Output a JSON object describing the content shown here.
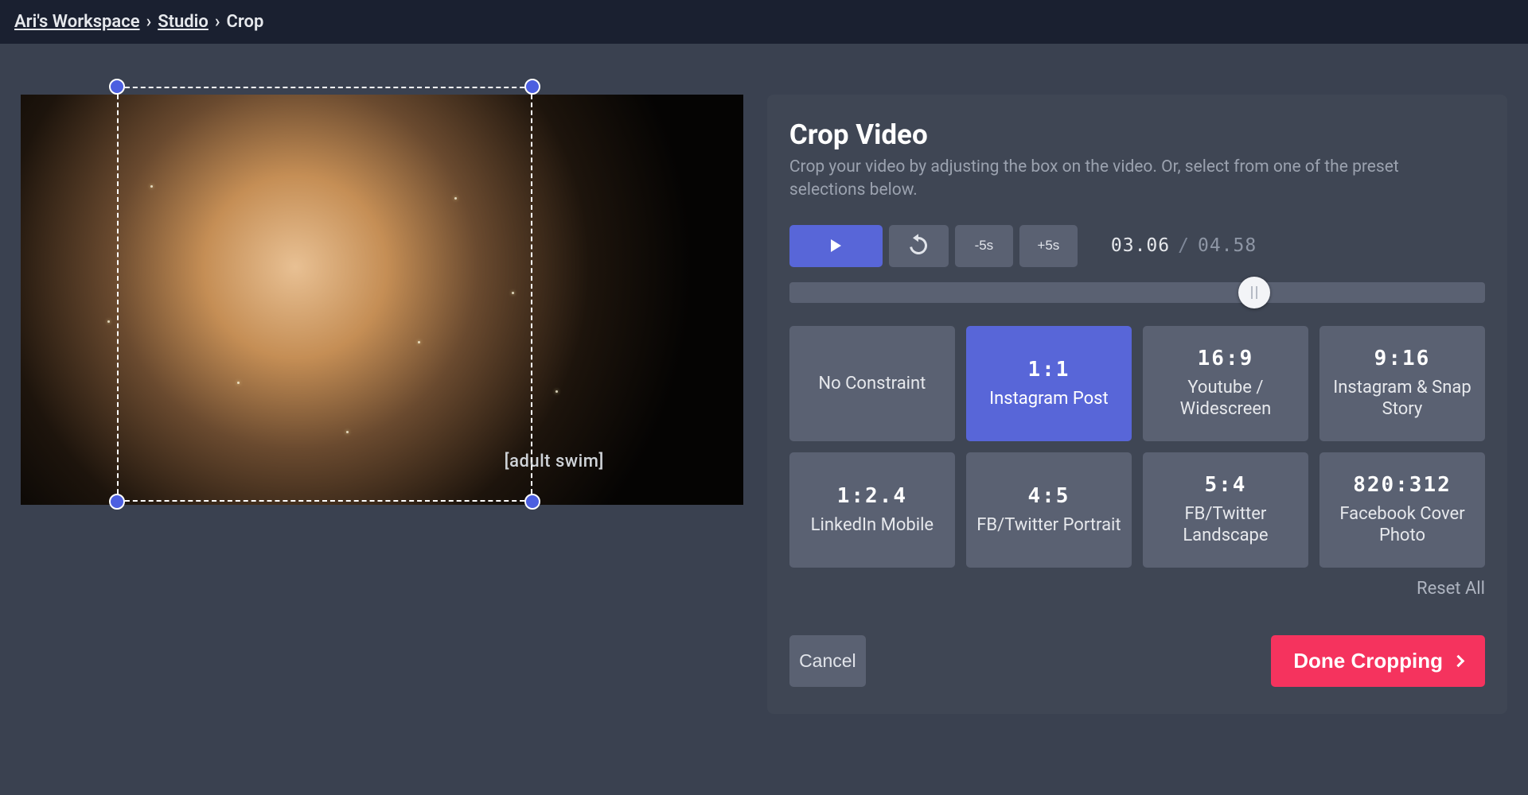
{
  "breadcrumb": {
    "workspace": "Ari's Workspace",
    "studio": "Studio",
    "current": "Crop"
  },
  "panel": {
    "title": "Crop Video",
    "subtitle": "Crop your video by adjusting the box on the video. Or, select from one of the preset selections below."
  },
  "controls": {
    "back5": "-5s",
    "fwd5": "+5s"
  },
  "time": {
    "current": "03.06",
    "total": "04.58",
    "progress_pct": 66.8
  },
  "presets": [
    {
      "ratio": "",
      "label": "No Constraint",
      "selected": false
    },
    {
      "ratio": "1:1",
      "label": "Instagram Post",
      "selected": true
    },
    {
      "ratio": "16:9",
      "label": "Youtube / Widescreen",
      "selected": false
    },
    {
      "ratio": "9:16",
      "label": "Instagram & Snap Story",
      "selected": false
    },
    {
      "ratio": "1:2.4",
      "label": "LinkedIn Mobile",
      "selected": false
    },
    {
      "ratio": "4:5",
      "label": "FB/Twitter Portrait",
      "selected": false
    },
    {
      "ratio": "5:4",
      "label": "FB/Twitter Landscape",
      "selected": false
    },
    {
      "ratio": "820:312",
      "label": "Facebook Cover Photo",
      "selected": false
    }
  ],
  "reset_all": "Reset All",
  "cancel": "Cancel",
  "done": "Done Cropping",
  "watermark": "[adult swim]"
}
